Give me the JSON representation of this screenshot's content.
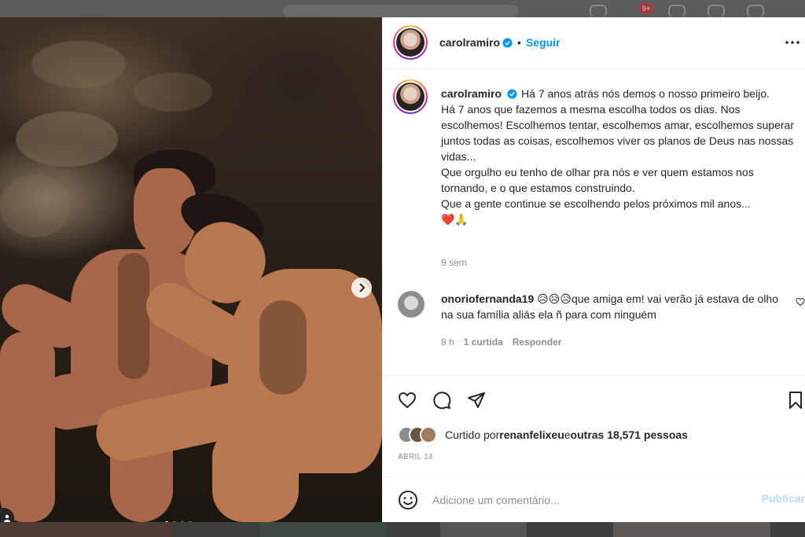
{
  "top_nav": {
    "notification_count": "9+"
  },
  "post": {
    "username": "carolramiro",
    "follow_label": "Seguir",
    "separator": "•",
    "caption_lines": "Há 7 anos atrás nós demos o nosso primeiro beijo.\nHá 7 anos que fazemos a mesma escolha todos os dias. Nos escolhemos! Escolhemos tentar, escolhemos amar, escolhemos superar juntos todas as coisas, escolhemos viver os planos de Deus nas nossas vidas...\nQue orgulho eu tenho de olhar pra nós e ver quem estamos nos tornando, e o que estamos construindo.\nQue a gente continue se escolhendo pelos próximos mil anos...\n❤️🙏",
    "caption_time": "9 sem",
    "carousel": {
      "current": 1,
      "total": 4
    },
    "icons": {
      "verified": "verified-badge-icon",
      "more": "more-options-icon",
      "next": "chevron-right-icon",
      "tag": "user-tag-icon",
      "like": "heart-icon",
      "comment": "comment-bubble-icon",
      "share": "paper-plane-icon",
      "save": "bookmark-icon",
      "emoji": "emoji-smile-icon"
    }
  },
  "comment": {
    "username": "onoriofernanda19",
    "emojis": "😥😥😥",
    "text": "que amiga em! vai verão já estava de olho na sua família aliás ela ñ para com ninguém",
    "time": "8 h",
    "likes_label": "1 curtida",
    "reply_label": "Responder"
  },
  "likes": {
    "prefix": "Curtido por ",
    "first_user": "renanfelixeu",
    "connector": " e ",
    "others": "outras 18,571 pessoas"
  },
  "date": "ABRIL 14",
  "add_comment": {
    "placeholder": "Adicione um comentário...",
    "post_label": "Publicar"
  },
  "colors": {
    "accent": "#0095f6",
    "post_disabled": "#b3dbff",
    "muted": "#8e8e8e",
    "text": "#262626"
  }
}
